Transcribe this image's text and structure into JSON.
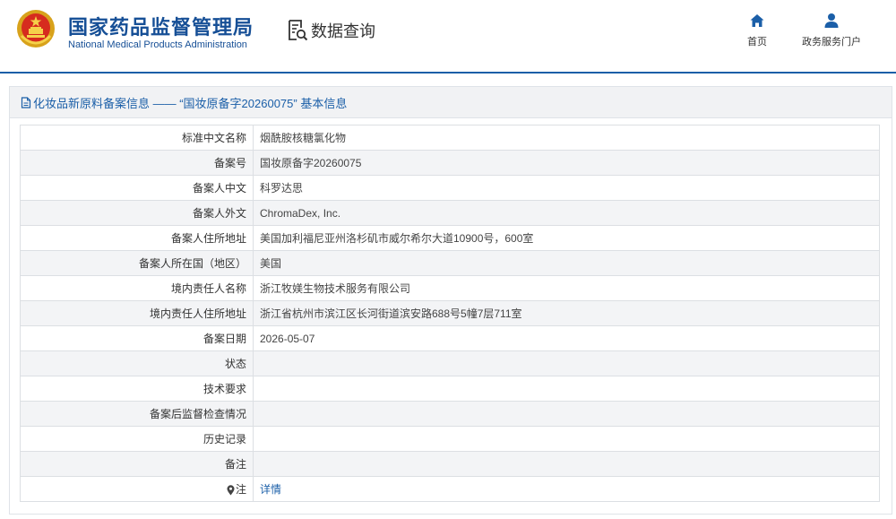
{
  "header": {
    "org_name_cn": "国家药品监督管理局",
    "org_name_en": "National Medical Products Administration",
    "data_query_label": "数据查询",
    "nav": {
      "home_label": "首页",
      "portal_label": "政务服务门户"
    }
  },
  "panel": {
    "title": "化妆品新原料备案信息 —— “国妆原备字20260075” 基本信息"
  },
  "record": {
    "rows": [
      {
        "label": "标准中文名称",
        "value": "烟酰胺核糖氯化物"
      },
      {
        "label": "备案号",
        "value": "国妆原备字20260075"
      },
      {
        "label": "备案人中文",
        "value": "科罗达思"
      },
      {
        "label": "备案人外文",
        "value": "ChromaDex, Inc."
      },
      {
        "label": "备案人住所地址",
        "value": "美国加利福尼亚州洛杉矶市威尔希尔大道10900号，600室"
      },
      {
        "label": "备案人所在国（地区）",
        "value": "美国"
      },
      {
        "label": "境内责任人名称",
        "value": "浙江牧媄生物技术服务有限公司"
      },
      {
        "label": "境内责任人住所地址",
        "value": "浙江省杭州市滨江区长河街道滨安路688号5幢7层711室"
      },
      {
        "label": "备案日期",
        "value": "2026-05-07"
      },
      {
        "label": "状态",
        "value": ""
      },
      {
        "label": "技术要求",
        "value": ""
      },
      {
        "label": "备案后监督检查情况",
        "value": ""
      },
      {
        "label": "历史记录",
        "value": ""
      },
      {
        "label": "备注",
        "value": ""
      }
    ],
    "note_label": "注",
    "note_link": "详情"
  },
  "colors": {
    "brand_blue": "#164f96",
    "link_blue": "#1b5fa8",
    "row_stripe": "#f3f4f6"
  },
  "icons": {
    "emblem": "national-emblem-icon",
    "data_query": "document-search-icon",
    "home": "home-icon",
    "portal": "user-icon",
    "title": "document-icon",
    "note": "pin-icon"
  }
}
